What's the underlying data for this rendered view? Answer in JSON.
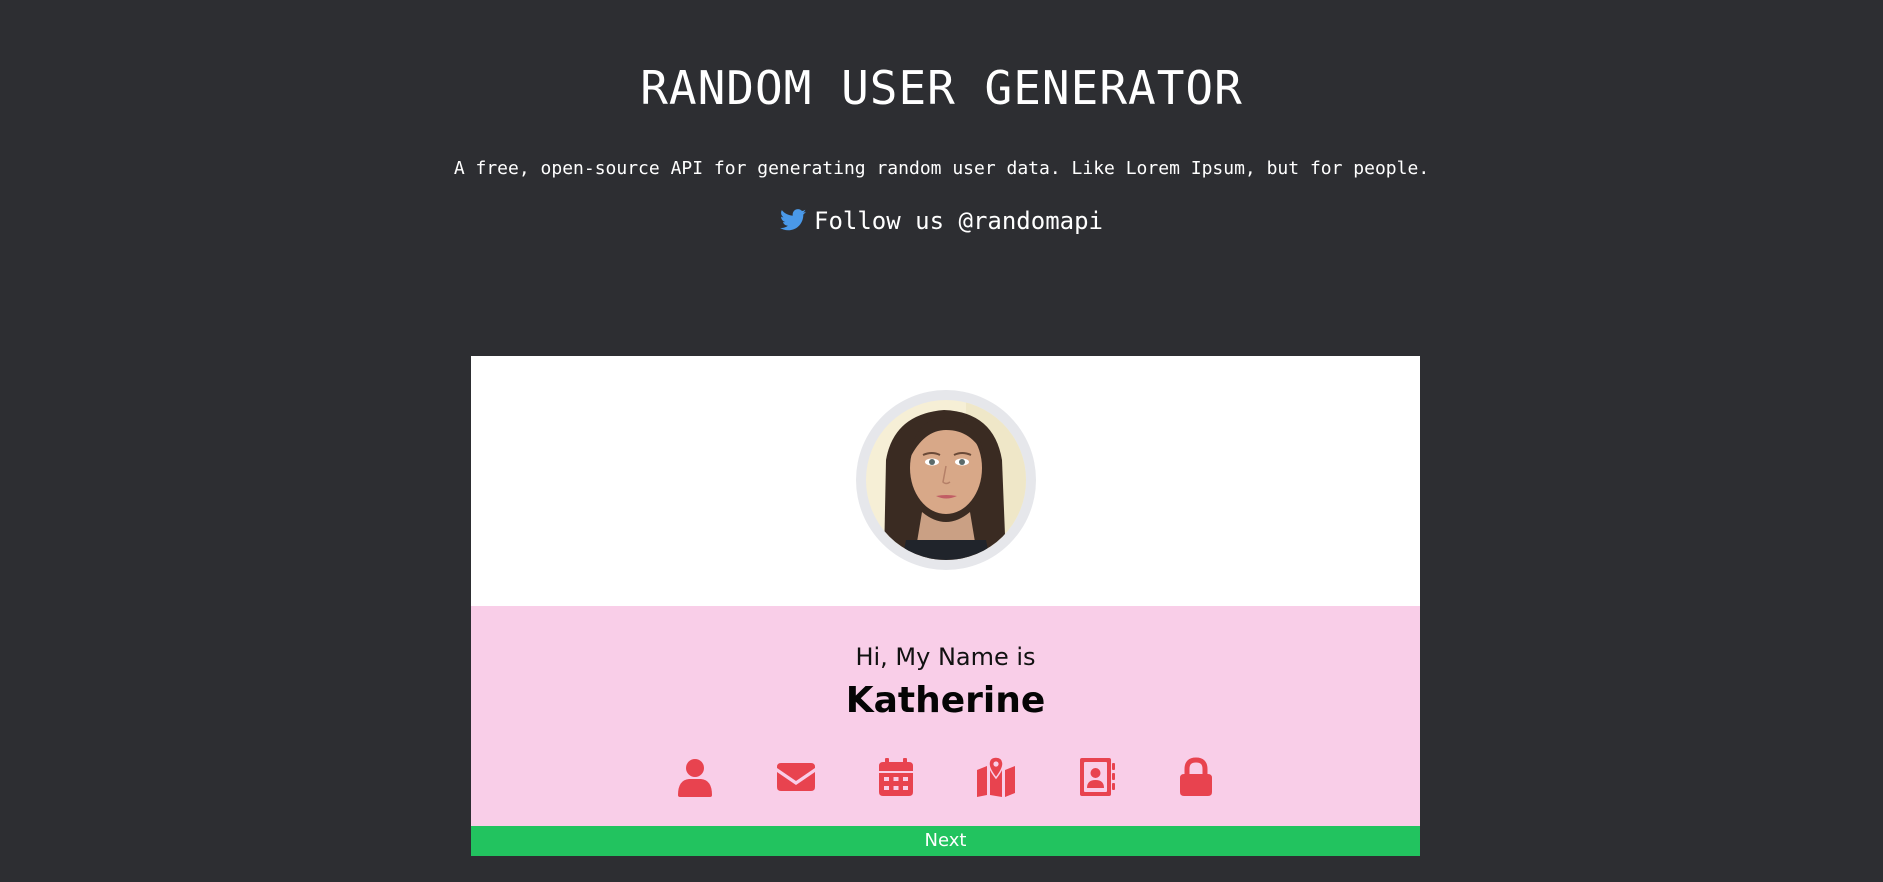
{
  "header": {
    "title": "RANDOM USER GENERATOR",
    "subtitle": "A free, open-source API for generating random user data. Like Lorem Ipsum, but for people.",
    "follow_label": "Follow us @randomapi"
  },
  "card": {
    "intro": "Hi, My Name is",
    "name": "Katherine",
    "icons": [
      "user-icon",
      "envelope-icon",
      "calendar-icon",
      "map-icon",
      "address-book-icon",
      "lock-icon"
    ],
    "next_label": "Next"
  },
  "colors": {
    "background": "#2d2e32",
    "card_top": "#ffffff",
    "card_mid": "#f9cee8",
    "icon": "#e8434f",
    "twitter": "#4a99e9",
    "next_button": "#22c35f"
  }
}
